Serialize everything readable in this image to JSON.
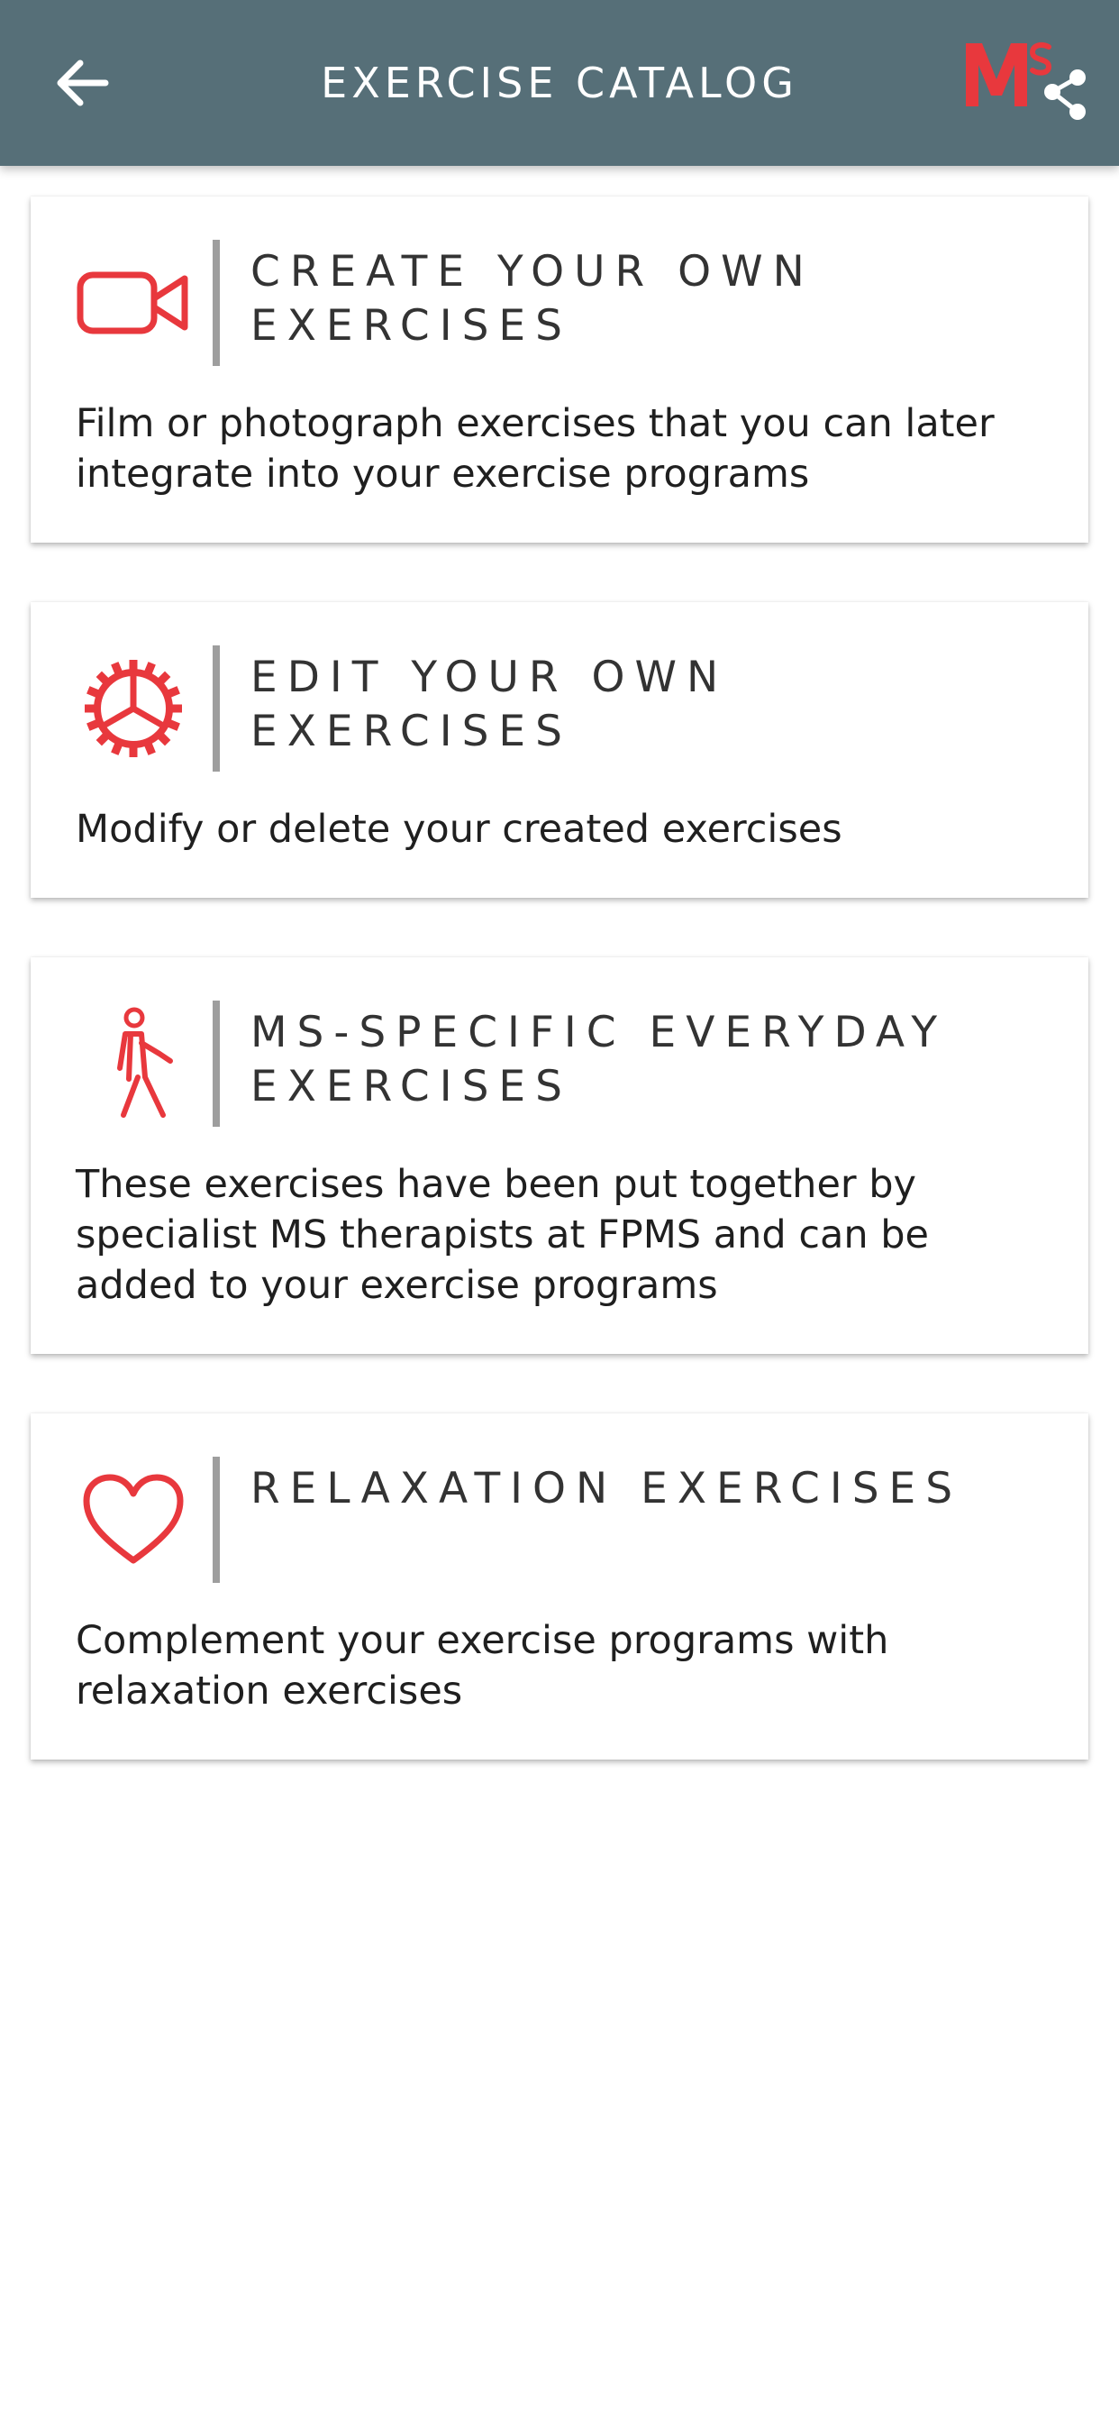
{
  "header": {
    "title": "EXERCISE CATALOG",
    "back_icon": "arrow-left-icon",
    "logo_icon": "ms-share-logo",
    "logo_letters": "MS"
  },
  "colors": {
    "app_bar": "#566f78",
    "accent_red": "#e8383d",
    "divider": "#9e9e9e"
  },
  "cards": [
    {
      "title": "CREATE YOUR OWN\nEXERCISES",
      "description": "Film or photograph exercises that you can later integrate into your exercise programs",
      "icon": "video-camera-icon"
    },
    {
      "title": "EDIT YOUR OWN\nEXERCISES",
      "description": "Modify or delete your created exercises",
      "icon": "gear-icon"
    },
    {
      "title": "MS-SPECIFIC EVERYDAY\nEXERCISES",
      "description": "These exercises have been put together by specialist MS therapists at FPMS and can be added to your exercise programs",
      "icon": "walking-person-icon"
    },
    {
      "title": "RELAXATION EXERCISES",
      "description": "Complement your exercise programs with relaxation exercises",
      "icon": "heart-icon"
    }
  ]
}
